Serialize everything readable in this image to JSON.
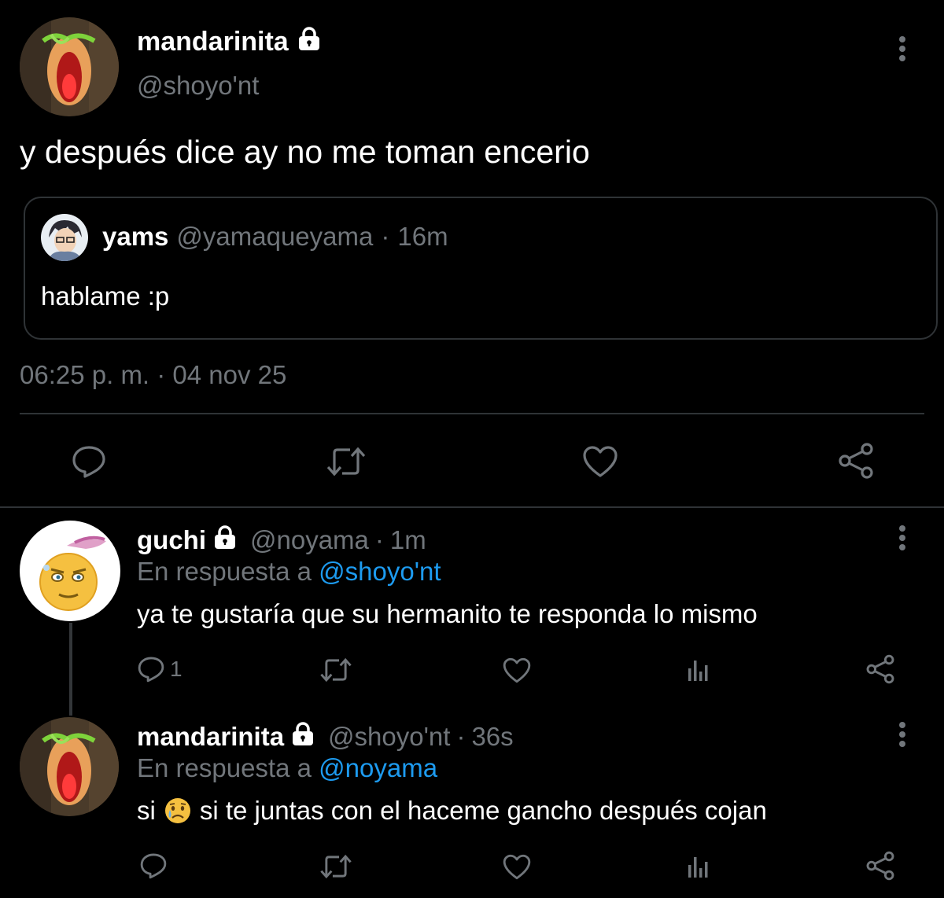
{
  "colors": {
    "background": "#000000",
    "text_primary": "#ffffff",
    "text_secondary": "#71767b",
    "mention": "#1d9bf0",
    "border": "#2f3336"
  },
  "main_tweet": {
    "author_name": "mandarinita",
    "lock_icon": "lock-icon",
    "handle": "@shoyo'nt",
    "text": "y después dice ay no me toman encerio",
    "quoted_tweet": {
      "author_name": "yams",
      "handle": "@yamaqueyama",
      "separator": "·",
      "time": "16m",
      "text": "hablame :p"
    },
    "timestamp": "06:25 p. m. · 04 nov 25",
    "actions": [
      "reply-icon",
      "retweet-icon",
      "like-icon",
      "share-icon"
    ]
  },
  "replies": [
    {
      "author_name": "guchi",
      "protected": true,
      "handle": "@noyama",
      "separator": "·",
      "time": "1m",
      "reply_prefix": "En respuesta a",
      "reply_to": "@shoyo'nt",
      "text": "ya te gustaría que su hermanito te responda lo mismo",
      "reply_count": "1",
      "actions": [
        "reply-icon",
        "retweet-icon",
        "like-icon",
        "analytics-icon",
        "share-icon"
      ]
    },
    {
      "author_name": "mandarinita",
      "protected": true,
      "handle": "@shoyo'nt",
      "separator": "·",
      "time": "36s",
      "reply_prefix": "En respuesta a",
      "reply_to": "@noyama",
      "text_before_emoji": "si",
      "emoji": "😥",
      "text_after_emoji": "si te juntas con el haceme gancho después cojan",
      "actions": [
        "reply-icon",
        "retweet-icon",
        "like-icon",
        "analytics-icon",
        "share-icon"
      ]
    }
  ]
}
